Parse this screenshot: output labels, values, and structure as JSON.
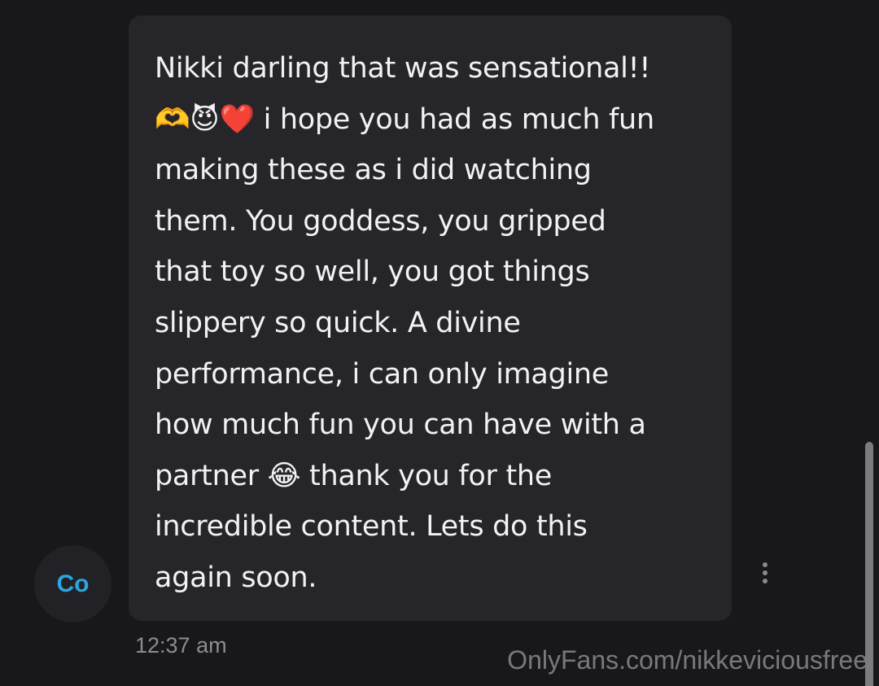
{
  "message": {
    "text": "Nikki darling that was sensational!!\n🫶😈❤️ i hope you had as much fun\nmaking these as i did watching\nthem. You goddess, you gripped\nthat toy so well, you got things\nslippery so quick. A divine\nperformance, i can only imagine\nhow much fun you can have with a\npartner 😂 thank you for the\nincredible content. Lets do this\nagain soon.",
    "timestamp": "12:37 am"
  },
  "sender": {
    "initials": "Co"
  },
  "more_button": {
    "icon": "vertical-dots-icon"
  },
  "watermark": {
    "text": "OnlyFans.com/nikkeviciousfree"
  },
  "colors": {
    "background": "#18181a",
    "bubble": "#26262a",
    "avatar_text": "#2aa6e2",
    "timestamp": "#8c8c94"
  }
}
